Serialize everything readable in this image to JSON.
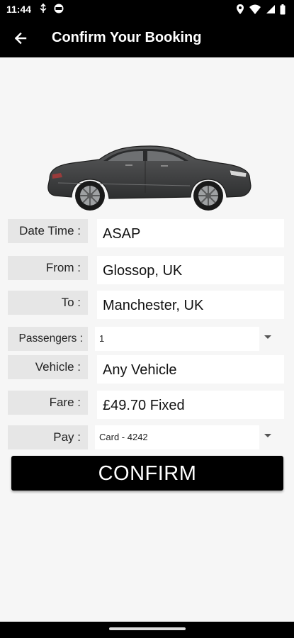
{
  "status_bar": {
    "time": "11:44",
    "left_icons": [
      "usb-debug-icon",
      "sync-icon"
    ],
    "right_icons": [
      "location-icon",
      "wifi-icon",
      "signal-icon",
      "battery-icon"
    ]
  },
  "app_bar": {
    "title": "Confirm Your Booking",
    "back_icon": "arrow-left-icon"
  },
  "booking": {
    "date_time": {
      "label": "Date Time :",
      "value": "ASAP"
    },
    "from": {
      "label": "From :",
      "value": "Glossop, UK"
    },
    "to": {
      "label": "To :",
      "value": "Manchester, UK"
    },
    "passengers": {
      "label": "Passengers :",
      "value": "1"
    },
    "vehicle": {
      "label": "Vehicle :",
      "value": "Any Vehicle"
    },
    "fare": {
      "label": "Fare :",
      "value": "£49.70 Fixed"
    },
    "pay": {
      "label": "Pay :",
      "value": "Card - 4242"
    }
  },
  "confirm_label": "CONFIRM",
  "colors": {
    "bar": "#000000",
    "background": "#f6f6f6",
    "label_bg": "#e6e6e6",
    "car": "#4a4b4c"
  }
}
